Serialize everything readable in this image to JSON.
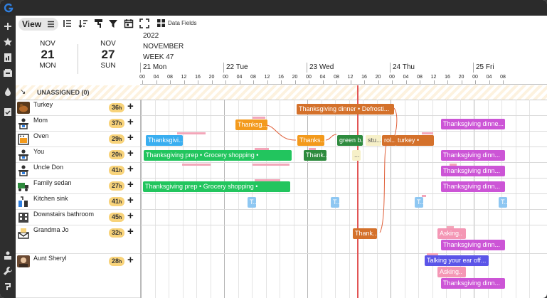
{
  "toolbar": {
    "view_label": "View",
    "data_fields_label": "Data Fields"
  },
  "date_header": {
    "start": {
      "month": "NOV",
      "day": "21",
      "weekday": "MON"
    },
    "end": {
      "month": "NOV",
      "day": "27",
      "weekday": "SUN"
    }
  },
  "timeline": {
    "year": "2022",
    "month": "NOVEMBER",
    "week": "WEEK 47",
    "days": [
      "21 Mon",
      "22 Tue",
      "23 Wed",
      "24 Thu",
      "25 Fri"
    ],
    "hours": [
      "00",
      "04",
      "08",
      "12",
      "16",
      "20",
      "00",
      "04",
      "08",
      "12",
      "16",
      "20",
      "00",
      "04",
      "08",
      "12",
      "16",
      "20",
      "00",
      "04",
      "08",
      "12",
      "16",
      "20",
      "00",
      "04",
      "08"
    ]
  },
  "unassigned_label": "UNASSIGNED (0)",
  "resources": [
    {
      "name": "Turkey",
      "hours": "36",
      "unit": "h",
      "icon": "turkey-photo-icon"
    },
    {
      "name": "Mom",
      "hours": "37",
      "unit": "h",
      "icon": "person-desk-icon"
    },
    {
      "name": "Oven",
      "hours": "29",
      "unit": "h",
      "icon": "oven-icon"
    },
    {
      "name": "You",
      "hours": "20",
      "unit": "h",
      "icon": "person-desk-icon"
    },
    {
      "name": "Uncle Don",
      "hours": "41",
      "unit": "h",
      "icon": "person-desk-icon"
    },
    {
      "name": "Family sedan",
      "hours": "27",
      "unit": "h",
      "icon": "truck-icon"
    },
    {
      "name": "Kitchen sink",
      "hours": "41",
      "unit": "h",
      "icon": "sink-icon"
    },
    {
      "name": "Downstairs bathroom",
      "hours": "45",
      "unit": "h",
      "icon": "building-icon"
    },
    {
      "name": "Grandma Jo",
      "hours": "32",
      "unit": "h",
      "icon": "envelope-icon"
    },
    {
      "name": "Aunt Sheryl",
      "hours": "28",
      "unit": "h",
      "icon": "person-photo-icon"
    }
  ],
  "events": [
    {
      "row": 0,
      "label": "Thanksgiving dinner • Defrosti...",
      "color": "#d4712b"
    },
    {
      "row": 1,
      "label": "Thanksg...",
      "color": "#f39a1c"
    },
    {
      "row": 1,
      "label": "Thanksgiving dinne...",
      "color": "#cc55d6"
    },
    {
      "row": 2,
      "label": "Thanksgivi...",
      "color": "#39aef0"
    },
    {
      "row": 2,
      "label": "Thanks...",
      "color": "#f39a1c"
    },
    {
      "row": 2,
      "label": "green b...",
      "color": "#2e8b3e"
    },
    {
      "row": 2,
      "label": "stu...",
      "color": "#f6f0c8"
    },
    {
      "row": 2,
      "label": "rol...",
      "color": "#d4712b"
    },
    {
      "row": 2,
      "label": "turkey •",
      "color": "#d4712b"
    },
    {
      "row": 3,
      "label": "Thanksgiving prep • Grocery shopping •",
      "color": "#22c55e"
    },
    {
      "row": 3,
      "label": "Thank...",
      "color": "#2e8b3e"
    },
    {
      "row": 3,
      "label": "...",
      "color": "#f6f0c8"
    },
    {
      "row": 3,
      "label": "Thanksgiving dinn...",
      "color": "#cc55d6"
    },
    {
      "row": 4,
      "label": "Thanksgiving dinn...",
      "color": "#cc55d6"
    },
    {
      "row": 5,
      "label": "Thanksgiving prep • Grocery shopping •",
      "color": "#22c55e"
    },
    {
      "row": 5,
      "label": "Thanksgiving dinn...",
      "color": "#cc55d6"
    },
    {
      "row": 6,
      "label": "T...",
      "color": "#8ec7f2"
    },
    {
      "row": 6,
      "label": "T...",
      "color": "#8ec7f2"
    },
    {
      "row": 6,
      "label": "T...",
      "color": "#8ec7f2"
    },
    {
      "row": 6,
      "label": "T...",
      "color": "#8ec7f2"
    },
    {
      "row": 8,
      "label": "Thank...",
      "color": "#d4712b"
    },
    {
      "row": 8,
      "label": "Asking..",
      "color": "#f497b5"
    },
    {
      "row": 8,
      "label": "Thanksgiving dinn...",
      "color": "#cc55d6"
    },
    {
      "row": 9,
      "label": "Talking your ear off...",
      "color": "#5b55e8"
    },
    {
      "row": 9,
      "label": "Asking..",
      "color": "#f497b5"
    },
    {
      "row": 9,
      "label": "Thanksgiving dinn...",
      "color": "#cc55d6"
    }
  ]
}
